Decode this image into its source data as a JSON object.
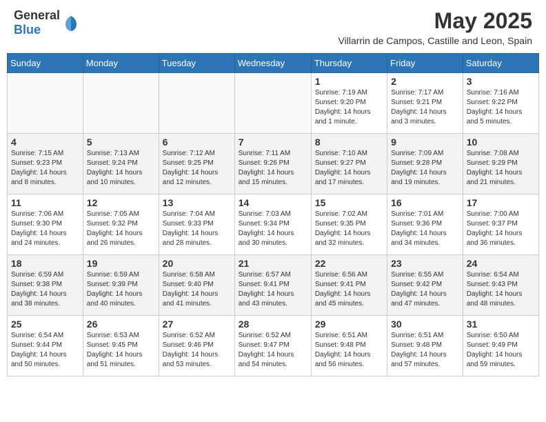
{
  "header": {
    "logo_general": "General",
    "logo_blue": "Blue",
    "month_year": "May 2025",
    "location": "Villarrin de Campos, Castille and Leon, Spain"
  },
  "days_of_week": [
    "Sunday",
    "Monday",
    "Tuesday",
    "Wednesday",
    "Thursday",
    "Friday",
    "Saturday"
  ],
  "weeks": [
    [
      {
        "day": "",
        "info": ""
      },
      {
        "day": "",
        "info": ""
      },
      {
        "day": "",
        "info": ""
      },
      {
        "day": "",
        "info": ""
      },
      {
        "day": "1",
        "info": "Sunrise: 7:19 AM\nSunset: 9:20 PM\nDaylight: 14 hours\nand 1 minute."
      },
      {
        "day": "2",
        "info": "Sunrise: 7:17 AM\nSunset: 9:21 PM\nDaylight: 14 hours\nand 3 minutes."
      },
      {
        "day": "3",
        "info": "Sunrise: 7:16 AM\nSunset: 9:22 PM\nDaylight: 14 hours\nand 5 minutes."
      }
    ],
    [
      {
        "day": "4",
        "info": "Sunrise: 7:15 AM\nSunset: 9:23 PM\nDaylight: 14 hours\nand 8 minutes."
      },
      {
        "day": "5",
        "info": "Sunrise: 7:13 AM\nSunset: 9:24 PM\nDaylight: 14 hours\nand 10 minutes."
      },
      {
        "day": "6",
        "info": "Sunrise: 7:12 AM\nSunset: 9:25 PM\nDaylight: 14 hours\nand 12 minutes."
      },
      {
        "day": "7",
        "info": "Sunrise: 7:11 AM\nSunset: 9:26 PM\nDaylight: 14 hours\nand 15 minutes."
      },
      {
        "day": "8",
        "info": "Sunrise: 7:10 AM\nSunset: 9:27 PM\nDaylight: 14 hours\nand 17 minutes."
      },
      {
        "day": "9",
        "info": "Sunrise: 7:09 AM\nSunset: 9:28 PM\nDaylight: 14 hours\nand 19 minutes."
      },
      {
        "day": "10",
        "info": "Sunrise: 7:08 AM\nSunset: 9:29 PM\nDaylight: 14 hours\nand 21 minutes."
      }
    ],
    [
      {
        "day": "11",
        "info": "Sunrise: 7:06 AM\nSunset: 9:30 PM\nDaylight: 14 hours\nand 24 minutes."
      },
      {
        "day": "12",
        "info": "Sunrise: 7:05 AM\nSunset: 9:32 PM\nDaylight: 14 hours\nand 26 minutes."
      },
      {
        "day": "13",
        "info": "Sunrise: 7:04 AM\nSunset: 9:33 PM\nDaylight: 14 hours\nand 28 minutes."
      },
      {
        "day": "14",
        "info": "Sunrise: 7:03 AM\nSunset: 9:34 PM\nDaylight: 14 hours\nand 30 minutes."
      },
      {
        "day": "15",
        "info": "Sunrise: 7:02 AM\nSunset: 9:35 PM\nDaylight: 14 hours\nand 32 minutes."
      },
      {
        "day": "16",
        "info": "Sunrise: 7:01 AM\nSunset: 9:36 PM\nDaylight: 14 hours\nand 34 minutes."
      },
      {
        "day": "17",
        "info": "Sunrise: 7:00 AM\nSunset: 9:37 PM\nDaylight: 14 hours\nand 36 minutes."
      }
    ],
    [
      {
        "day": "18",
        "info": "Sunrise: 6:59 AM\nSunset: 9:38 PM\nDaylight: 14 hours\nand 38 minutes."
      },
      {
        "day": "19",
        "info": "Sunrise: 6:59 AM\nSunset: 9:39 PM\nDaylight: 14 hours\nand 40 minutes."
      },
      {
        "day": "20",
        "info": "Sunrise: 6:58 AM\nSunset: 9:40 PM\nDaylight: 14 hours\nand 41 minutes."
      },
      {
        "day": "21",
        "info": "Sunrise: 6:57 AM\nSunset: 9:41 PM\nDaylight: 14 hours\nand 43 minutes."
      },
      {
        "day": "22",
        "info": "Sunrise: 6:56 AM\nSunset: 9:41 PM\nDaylight: 14 hours\nand 45 minutes."
      },
      {
        "day": "23",
        "info": "Sunrise: 6:55 AM\nSunset: 9:42 PM\nDaylight: 14 hours\nand 47 minutes."
      },
      {
        "day": "24",
        "info": "Sunrise: 6:54 AM\nSunset: 9:43 PM\nDaylight: 14 hours\nand 48 minutes."
      }
    ],
    [
      {
        "day": "25",
        "info": "Sunrise: 6:54 AM\nSunset: 9:44 PM\nDaylight: 14 hours\nand 50 minutes."
      },
      {
        "day": "26",
        "info": "Sunrise: 6:53 AM\nSunset: 9:45 PM\nDaylight: 14 hours\nand 51 minutes."
      },
      {
        "day": "27",
        "info": "Sunrise: 6:52 AM\nSunset: 9:46 PM\nDaylight: 14 hours\nand 53 minutes."
      },
      {
        "day": "28",
        "info": "Sunrise: 6:52 AM\nSunset: 9:47 PM\nDaylight: 14 hours\nand 54 minutes."
      },
      {
        "day": "29",
        "info": "Sunrise: 6:51 AM\nSunset: 9:48 PM\nDaylight: 14 hours\nand 56 minutes."
      },
      {
        "day": "30",
        "info": "Sunrise: 6:51 AM\nSunset: 9:48 PM\nDaylight: 14 hours\nand 57 minutes."
      },
      {
        "day": "31",
        "info": "Sunrise: 6:50 AM\nSunset: 9:49 PM\nDaylight: 14 hours\nand 59 minutes."
      }
    ]
  ]
}
